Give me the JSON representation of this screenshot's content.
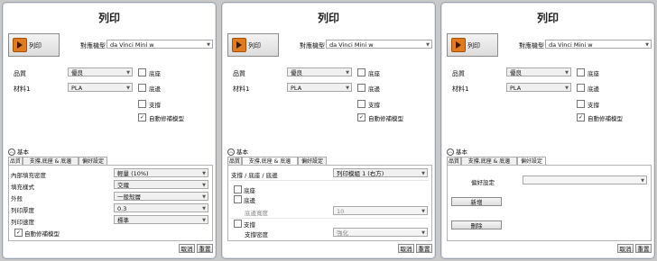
{
  "panels": [
    {
      "title": "列印",
      "print_button": "列印",
      "machine_label": "對應機型",
      "machine_value": "da Vinci Mini w",
      "quality_label": "品質",
      "quality_value": "優良",
      "material_label": "材料1",
      "material_value": "PLA",
      "raft_label": "底座",
      "brim_label": "底邊",
      "support_label": "支撐",
      "autofix_label": "自動修補模型",
      "autofix_checked": true,
      "section_label": "基本",
      "tabs": [
        "品質",
        "支撐,底座 & 底邊",
        "偏好設定"
      ],
      "active_tab": 0,
      "rows": [
        {
          "label": "內部填充密度",
          "value": "輕量 (10%)"
        },
        {
          "label": "填充樣式",
          "value": "交織"
        },
        {
          "label": "外殼",
          "value": "一般殼層"
        },
        {
          "label": "列印厚度",
          "value": "0.3"
        },
        {
          "label": "列印速度",
          "value": "標準"
        }
      ],
      "tab_autofix_label": "自動修補模型",
      "cancel": "取消",
      "reset": "重置"
    },
    {
      "title": "列印",
      "print_button": "列印",
      "machine_label": "對應機型",
      "machine_value": "da Vinci Mini w",
      "quality_label": "品質",
      "quality_value": "優良",
      "material_label": "材料1",
      "material_value": "PLA",
      "raft_label": "底座",
      "brim_label": "底邊",
      "support_label": "支撐",
      "autofix_label": "自動修補模型",
      "section_label": "基本",
      "tabs": [
        "品質",
        "支撐,底座 & 底邊",
        "偏好設定"
      ],
      "support_header_label": "支撐 / 底座 / 底邊",
      "support_header_value": "列印模組 1 (右方)",
      "raft_label2": "底座",
      "brim_label2": "底邊",
      "brim_width_label": "底邊寬度",
      "brim_width_value": "10",
      "support_label2": "支撐",
      "support_density_label": "支撐密度",
      "support_density_value": "強化",
      "cancel": "取消",
      "reset": "重置"
    },
    {
      "title": "列印",
      "print_button": "列印",
      "machine_label": "對應機型",
      "machine_value": "da Vinci Mini w",
      "quality_label": "品質",
      "quality_value": "優良",
      "material_label": "材料1",
      "material_value": "PLA",
      "raft_label": "底座",
      "brim_label": "底邊",
      "support_label": "支撐",
      "autofix_label": "自動修補模型",
      "section_label": "基本",
      "tabs": [
        "品質",
        "支撐,底座 & 底邊",
        "偏好設定"
      ],
      "pref_label": "偏好設定",
      "pref_value": "",
      "new_button": "新增",
      "delete_button": "刪除",
      "cancel": "取消",
      "reset": "重置"
    }
  ]
}
